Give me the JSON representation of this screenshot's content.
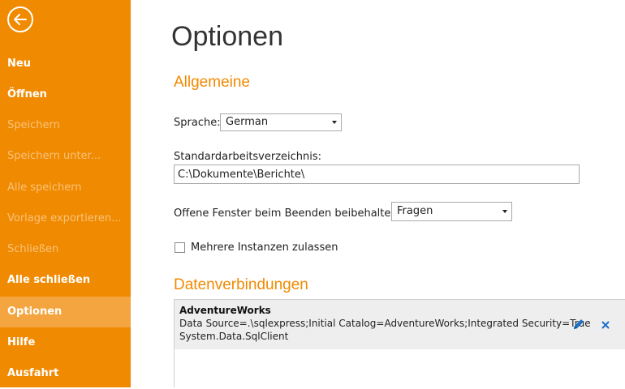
{
  "sidebar": {
    "items": [
      {
        "label": "Neu"
      },
      {
        "label": "Öffnen"
      },
      {
        "label": "Speichern"
      },
      {
        "label": "Speichern unter..."
      },
      {
        "label": "Alle speichern"
      },
      {
        "label": "Vorlage exportieren..."
      },
      {
        "label": "Schließen"
      },
      {
        "label": "Alle schließen"
      },
      {
        "label": "Optionen"
      },
      {
        "label": "Hilfe"
      },
      {
        "label": "Ausfahrt"
      }
    ]
  },
  "page": {
    "title": "Optionen"
  },
  "general": {
    "heading": "Allgemeine",
    "language_label": "Sprache:",
    "language_value": "German",
    "workdir_label": "Standardarbeitsverzeichnis:",
    "workdir_value": "C:\\Dokumente\\Berichte\\",
    "keep_windows_label": "Offene Fenster beim Beenden beibehalten:",
    "keep_windows_value": "Fragen",
    "multi_instance_label": "Mehrere Instanzen zulassen",
    "multi_instance_checked": false
  },
  "connections": {
    "heading": "Datenverbindungen",
    "items": [
      {
        "name": "AdventureWorks",
        "connection_string": "Data Source=.\\sqlexpress;Initial Catalog=AdventureWorks;Integrated Security=True",
        "provider": "System.Data.SqlClient"
      }
    ]
  },
  "colors": {
    "accent": "#f08a00",
    "sidebar_active": "#f5a540",
    "edit_icon": "#1e6fc7"
  }
}
